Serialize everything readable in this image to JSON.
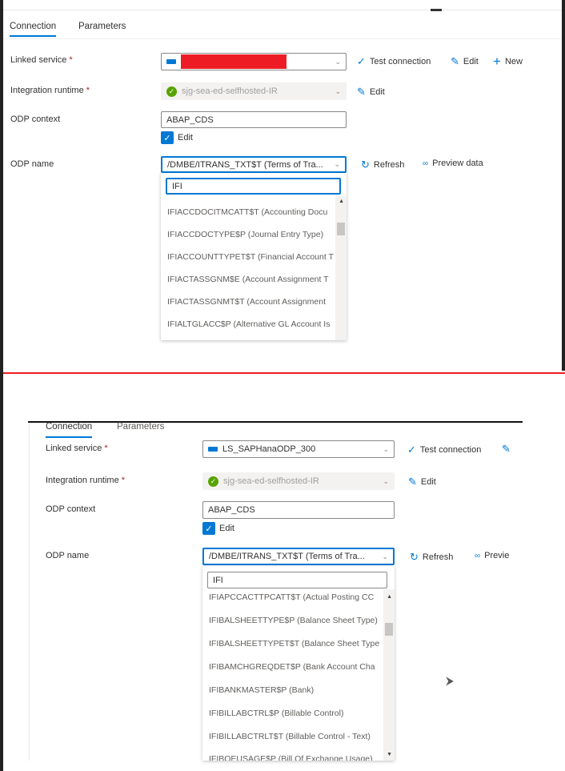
{
  "top": {
    "tabs": [
      "Connection",
      "Parameters"
    ],
    "linked_service": {
      "label": "Linked service",
      "value": ""
    },
    "integration_runtime": {
      "label": "Integration runtime",
      "value": "sjg-sea-ed-selfhosted-IR"
    },
    "odp_context": {
      "label": "ODP context",
      "value": "ABAP_CDS"
    },
    "edit_checkbox": "Edit",
    "odp_name": {
      "label": "ODP name",
      "value": "/DMBE/ITRANS_TXT$T (Terms of Tra..."
    },
    "actions": {
      "test_connection": "Test connection",
      "edit": "Edit",
      "new": "New",
      "refresh": "Refresh",
      "preview": "Preview data"
    },
    "search": "IFI",
    "items": [
      "IFIACCDOCITMCATT$T (Accounting Docu",
      "IFIACCDOCTYPE$P (Journal Entry Type)",
      "IFIACCOUNTTYPET$T (Financial Account T",
      "IFIACTASSGNM$E (Account Assignment T",
      "IFIACTASSGNMT$T (Account Assignment",
      "IFIALTGLACC$P (Alternative GL Account Is"
    ]
  },
  "bottom": {
    "tabs": [
      "Connection",
      "Parameters"
    ],
    "linked_service": {
      "label": "Linked service",
      "value": "LS_SAPHanaODP_300"
    },
    "integration_runtime": {
      "label": "Integration runtime",
      "value": "sjg-sea-ed-selfhosted-IR"
    },
    "odp_context": {
      "label": "ODP context",
      "value": "ABAP_CDS"
    },
    "edit_checkbox": "Edit",
    "odp_name": {
      "label": "ODP name",
      "value": "/DMBE/ITRANS_TXT$T (Terms of Tra..."
    },
    "actions": {
      "test_connection": "Test connection",
      "edit": "Edit",
      "refresh": "Refresh",
      "preview": "Previe"
    },
    "search": "IFI",
    "items": [
      "IFIAPCCACTTPCATT$T (Actual Posting CC",
      "IFIBALSHEETTYPE$P (Balance Sheet Type)",
      "IFIBALSHEETTYPET$T (Balance Sheet Type",
      "IFIBAMCHGREQDET$P (Bank Account Cha",
      "IFIBANKMASTER$P (Bank)",
      "IFIBILLABCTRL$P (Billable Control)",
      "IFIBILLABCTRLT$T (Billable Control - Text)",
      "IFIBOEUSAGE$P (Bill Of Exchange Usage)"
    ]
  },
  "colors": {
    "accent": "#0078d4",
    "redaction": "#ed1c24",
    "divider": "#ed1c24"
  }
}
